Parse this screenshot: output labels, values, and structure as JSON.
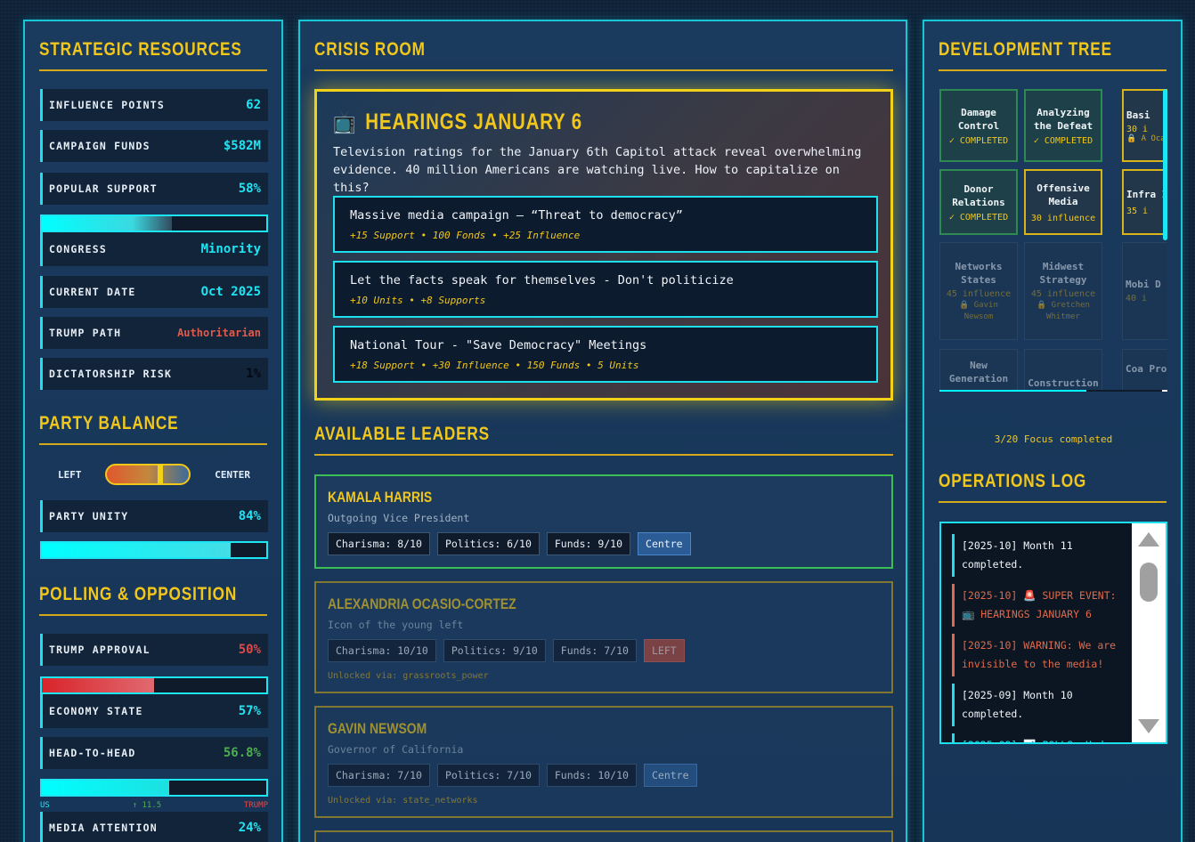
{
  "left": {
    "resources_title": "STRATEGIC RESOURCES",
    "stats": [
      {
        "label": "INFLUENCE POINTS",
        "value": "62"
      },
      {
        "label": "CAMPAIGN FUNDS",
        "value": "$582M"
      },
      {
        "label": "POPULAR SUPPORT",
        "value": "58%"
      },
      {
        "label": "CONGRESS",
        "value": "Minority"
      },
      {
        "label": "CURRENT DATE",
        "value": "Oct 2025"
      },
      {
        "label": "TRUMP PATH",
        "value": "Authoritarian"
      },
      {
        "label": "DICTATORSHIP RISK",
        "value": "1%"
      }
    ],
    "popular_support_level": 0.58,
    "party_title": "PARTY BALANCE",
    "balance_left": "LEFT",
    "balance_right": "CENTER",
    "party_unity_label": "PARTY UNITY",
    "party_unity_value": "84%",
    "party_unity_level": 0.84,
    "polling_title": "POLLING & OPPOSITION",
    "trump_approval_label": "TRUMP APPROVAL",
    "trump_approval_value": "50%",
    "trump_approval_level": 0.5,
    "economy_label": "ECONOMY STATE",
    "economy_value": "57%",
    "h2h_label": "HEAD-TO-HEAD",
    "h2h_value": "56.8%",
    "h2h_level": 0.568,
    "h2h_us": "US",
    "h2h_margin": "↑ 11.5",
    "h2h_trump": "TRUMP",
    "media_label": "MEDIA ATTENTION",
    "media_value": "24%",
    "colors": {
      "accent": "#1de6f4",
      "gold": "#f2c71b",
      "red": "#e05a4a",
      "green": "#4caf50"
    }
  },
  "center": {
    "crisis_title": "CRISIS ROOM",
    "event_icon": "tv-icon",
    "event_title": "HEARINGS JANUARY 6",
    "event_desc": "Television ratings for the January 6th Capitol attack reveal overwhelming evidence. 40 million Americans are watching live. How to capitalize on this?",
    "options": [
      {
        "title": "Massive media campaign – “Threat to democracy”",
        "effects": "+15 Support • 100 Fonds • +25 Influence"
      },
      {
        "title": "Let the facts speak for themselves - Don't politicize",
        "effects": "+10 Units • +8 Supports"
      },
      {
        "title": "National Tour - \"Save Democracy\" Meetings",
        "effects": "+18 Support • +30 Influence • 150 Funds • 5 Units"
      }
    ],
    "leaders_title": "AVAILABLE LEADERS",
    "leaders": [
      {
        "name": "KAMALA HARRIS",
        "sub": "Outgoing Vice President",
        "charisma": "Charisma: 8/10",
        "politics": "Politics: 6/10",
        "funds": "Funds: 9/10",
        "tag": "Centre",
        "unlock": ""
      },
      {
        "name": "ALEXANDRIA OCASIO-CORTEZ",
        "sub": "Icon of the young left",
        "charisma": "Charisma: 10/10",
        "politics": "Politics: 9/10",
        "funds": "Funds: 7/10",
        "tag": "LEFT",
        "unlock": "Unlocked via: grassroots_power"
      },
      {
        "name": "GAVIN NEWSOM",
        "sub": "Governor of California",
        "charisma": "Charisma: 7/10",
        "politics": "Politics: 7/10",
        "funds": "Funds: 10/10",
        "tag": "Centre",
        "unlock": "Unlocked via: state_networks"
      }
    ]
  },
  "right": {
    "tree_title": "DEVELOPMENT TREE",
    "nodes": {
      "damage": {
        "name": "Damage Control",
        "status": "✓ COMPLETED"
      },
      "analyzing": {
        "name": "Analyzing the Defeat",
        "status": "✓ COMPLETED"
      },
      "basic": {
        "name": "Basi",
        "cost": "30 i",
        "req": "🔒 A Ocas"
      },
      "donor": {
        "name": "Donor Relations",
        "status": "✓ COMPLETED"
      },
      "offensive": {
        "name": "Offensive Media",
        "cost": "30 influence"
      },
      "infra": {
        "name": "Infra I",
        "cost": "35 i"
      },
      "networks": {
        "name": "Networks States",
        "cost": "45 influence",
        "req": "🔒 Gavin Newsom"
      },
      "midwest": {
        "name": "Midwest Strategy",
        "cost": "45 influence",
        "req": "🔒 Gretchen Whitmer"
      },
      "mobi": {
        "name": "Mobi D",
        "cost": "40 i"
      },
      "newgen": {
        "name": "New Generation"
      },
      "construction": {
        "name": "Construction"
      },
      "coa": {
        "name": "Coa Proc"
      }
    },
    "focus_level": 0.15,
    "focus_text": "3/20 Focus completed",
    "log_title": "OPERATIONS LOG",
    "log": [
      {
        "text": "[2025-10] Month 11 completed.",
        "color": "#f0f4f8"
      },
      {
        "text": "[2025-10] 🚨 SUPER EVENT: 📺 HEARINGS JANUARY 6",
        "color": "#e06a4a"
      },
      {
        "text": "[2025-10] WARNING: We are invisible to the media!",
        "color": "#e06a4a"
      },
      {
        "text": "[2025-09] Month 10 completed.",
        "color": "#f0f4f8"
      },
      {
        "text": "[2025-09] 📊 POLLS: Unde",
        "color": "#1de6f4"
      }
    ]
  }
}
